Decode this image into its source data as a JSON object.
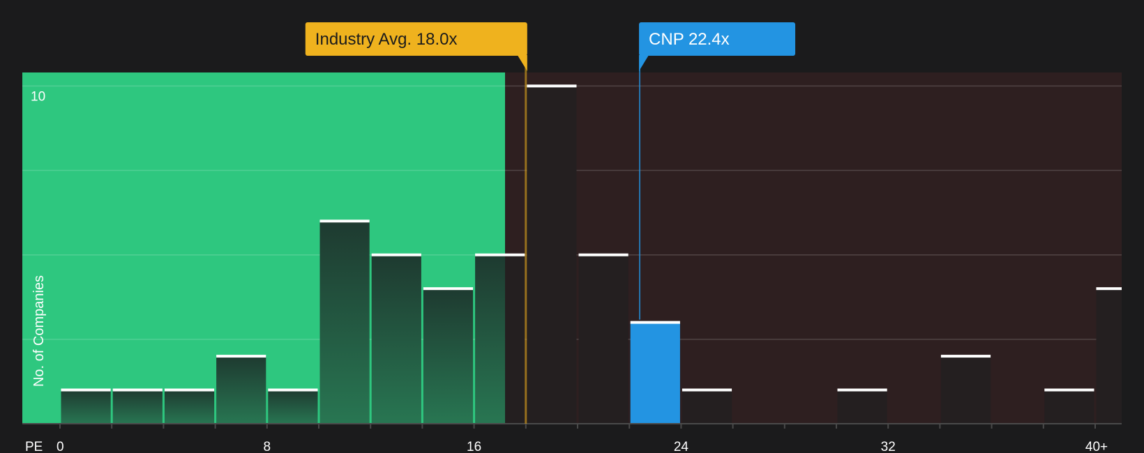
{
  "chart_data": {
    "type": "bar",
    "xlabel": "PE",
    "ylabel": "No. of Companies",
    "bin_width": 2,
    "x_ticks": [
      "0",
      "8",
      "16",
      "24",
      "32",
      "40+"
    ],
    "x_tick_values": [
      0,
      8,
      16,
      24,
      32,
      40
    ],
    "y_ticks": [
      "10"
    ],
    "y_tick_values": [
      10
    ],
    "ylim": [
      0,
      10.4
    ],
    "grid": true,
    "gridlines": [
      0,
      2.5,
      5,
      7.5,
      10
    ],
    "bins": [
      {
        "x0": 0,
        "value": 1
      },
      {
        "x0": 2,
        "value": 1
      },
      {
        "x0": 4,
        "value": 1
      },
      {
        "x0": 6,
        "value": 2
      },
      {
        "x0": 8,
        "value": 1
      },
      {
        "x0": 10,
        "value": 6
      },
      {
        "x0": 12,
        "value": 5
      },
      {
        "x0": 14,
        "value": 4
      },
      {
        "x0": 16,
        "value": 5
      },
      {
        "x0": 18,
        "value": 10
      },
      {
        "x0": 20,
        "value": 5
      },
      {
        "x0": 22,
        "value": 3
      },
      {
        "x0": 24,
        "value": 1
      },
      {
        "x0": 26,
        "value": 0
      },
      {
        "x0": 28,
        "value": 0
      },
      {
        "x0": 30,
        "value": 1
      },
      {
        "x0": 32,
        "value": 0
      },
      {
        "x0": 34,
        "value": 2
      },
      {
        "x0": 36,
        "value": 0
      },
      {
        "x0": 38,
        "value": 1
      },
      {
        "x0": 40,
        "value": 4
      }
    ],
    "highlight_bin_x0": 22,
    "undervalued_max": 17.2,
    "annotations": [
      {
        "label": "Industry Avg. 18.0x",
        "value": 18.0,
        "color": "#efb21e"
      },
      {
        "label": "CNP 22.4x",
        "value": 22.4,
        "color": "#2394e2"
      }
    ],
    "colors": {
      "background": "#1b1b1c",
      "undervalued_zone": "#2ec77f",
      "overvalued_zone": "#2e1f20",
      "bar_green_zone": "#23473a",
      "bar_dark_zone": "#241f20",
      "bar_highlight": "#2394e2",
      "bar_cap": "#ffffff",
      "gridline": "#ffffff",
      "axis": "#4a4a4a"
    }
  }
}
